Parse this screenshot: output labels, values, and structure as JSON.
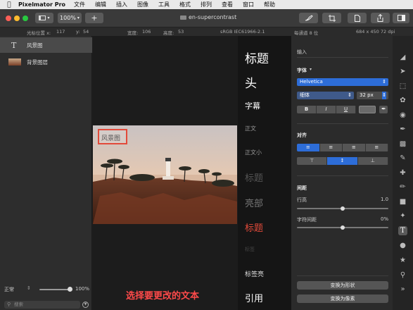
{
  "menubar": {
    "apple_icon": "apple-logo-icon",
    "app_name": "Pixelmator Pro",
    "items": [
      "文件",
      "编辑",
      "插入",
      "图像",
      "工具",
      "格式",
      "排列",
      "查看",
      "窗口",
      "帮助"
    ]
  },
  "toolbar": {
    "zoom": "100%",
    "add": "+",
    "document_title": "en-supercontrast"
  },
  "infobar": {
    "cursor_label": "光标位置 x:",
    "cursor_x": "117",
    "y_label": "y:",
    "cursor_y": "54",
    "width_label": "宽度:",
    "width": "106",
    "height_label": "高度:",
    "height": "53",
    "color_profile": "sRGB IEC61966-2.1",
    "bit_depth": "每通道 8 位",
    "image_size": "684 x 450 72 dpi"
  },
  "layers": {
    "items": [
      {
        "name": "风景图",
        "type": "text",
        "selected": true
      },
      {
        "name": "背景图层",
        "type": "image",
        "selected": false
      }
    ],
    "blend_mode": "正常",
    "opacity": "100%",
    "search_placeholder": "搜索"
  },
  "canvas": {
    "text_layer": "风景图",
    "caption": "选择要更改的文本"
  },
  "styles": {
    "items": [
      "标题",
      "头",
      "字幕",
      "正文",
      "正文小",
      "标题",
      "亮部",
      "标题",
      "标签",
      "标签亮",
      "引用"
    ]
  },
  "inspector": {
    "input_label": "输入",
    "font_section": "字体",
    "font_family": "Helvetica",
    "font_weight": "细体",
    "font_size": "32 px",
    "style_buttons": [
      "B",
      "I",
      "U"
    ],
    "align_section": "对齐",
    "spacing_section": "间距",
    "line_height_label": "行高",
    "line_height_value": "1.0",
    "char_spacing_label": "字符间距",
    "char_spacing_value": "0%",
    "convert_shape": "变换为形状",
    "convert_pixels": "变换为像素"
  },
  "colors": {
    "accent": "#2d6dd8",
    "caption": "#ff4a4a",
    "highlight": "#e24a3a",
    "close": "#fc5f57",
    "minimize": "#fdbb2e",
    "zoom": "#28c840"
  }
}
